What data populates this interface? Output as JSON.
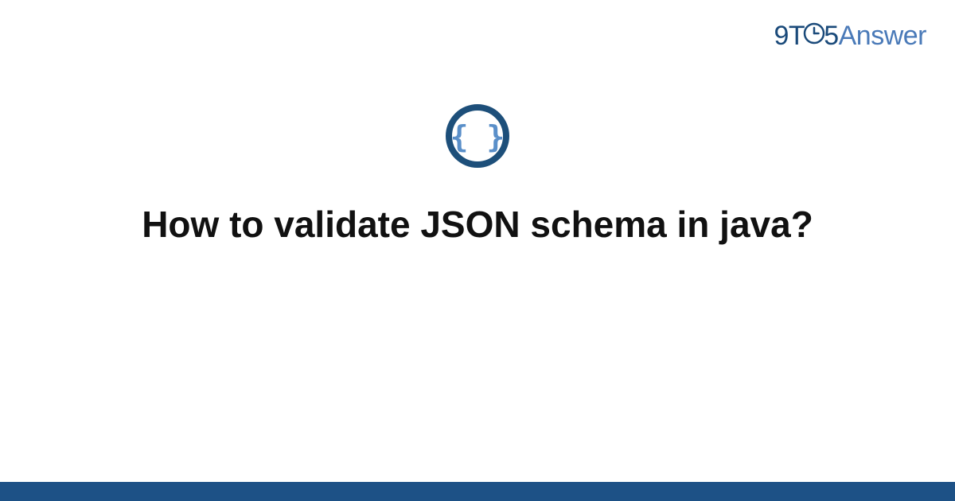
{
  "brand": {
    "part1": "9",
    "part2": "T",
    "part3": "5",
    "part4": "Answer"
  },
  "icon": {
    "name": "json-braces-icon",
    "ring_color": "#1d4f7a",
    "brace_color": "#5a8fc9"
  },
  "title": "How to validate JSON schema in java?",
  "colors": {
    "bottom_bar": "#1d5186",
    "brand_dark": "#1a4a7a",
    "brand_light": "#4a7ab8"
  }
}
